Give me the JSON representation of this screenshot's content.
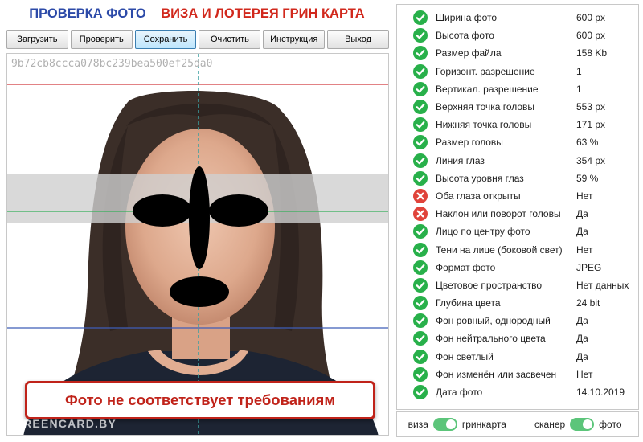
{
  "header": {
    "title_left": "ПРОВЕРКА ФОТО",
    "title_right": "ВИЗА И ЛОТЕРЕЯ ГРИН КАРТА"
  },
  "toolbar": {
    "load_label": "Загрузить",
    "check_label": "Проверить",
    "save_label": "Сохранить",
    "clear_label": "Очистить",
    "instruction_label": "Инструкция",
    "exit_label": "Выход"
  },
  "photo": {
    "hash": "9b72cb8ccca078bc239bea500ef25da0",
    "verdict": "Фото не соответствует требованиям",
    "watermark": "GREENCARD.BY"
  },
  "colors": {
    "pass": "#28b04a",
    "fail": "#e0433a",
    "title_blue": "#2c4aa8",
    "title_red": "#d1281c",
    "toggle_on": "#5cc57a"
  },
  "checks": [
    {
      "label": "Ширина фото",
      "value": "600 px",
      "status": "ok"
    },
    {
      "label": "Высота фото",
      "value": "600 px",
      "status": "ok"
    },
    {
      "label": "Размер файла",
      "value": "158 Kb",
      "status": "ok"
    },
    {
      "label": "Горизонт. разрешение",
      "value": "1",
      "status": "ok"
    },
    {
      "label": "Вертикал. разрешение",
      "value": "1",
      "status": "ok"
    },
    {
      "label": "Верхняя точка головы",
      "value": "553 px",
      "status": "ok"
    },
    {
      "label": "Нижняя точка головы",
      "value": "171 px",
      "status": "ok"
    },
    {
      "label": "Размер головы",
      "value": "63 %",
      "status": "ok"
    },
    {
      "label": "Линия глаз",
      "value": "354 px",
      "status": "ok"
    },
    {
      "label": "Высота уровня глаз",
      "value": "59 %",
      "status": "ok"
    },
    {
      "label": "Оба глаза открыты",
      "value": "Нет",
      "status": "fail"
    },
    {
      "label": "Наклон или поворот головы",
      "value": "Да",
      "status": "fail"
    },
    {
      "label": "Лицо по центру фото",
      "value": "Да",
      "status": "ok"
    },
    {
      "label": "Тени на лице (боковой свет)",
      "value": "Нет",
      "status": "ok"
    },
    {
      "label": "Формат фото",
      "value": "JPEG",
      "status": "ok"
    },
    {
      "label": "Цветовое пространство",
      "value": "Нет данных",
      "status": "ok"
    },
    {
      "label": "Глубина цвета",
      "value": "24 bit",
      "status": "ok"
    },
    {
      "label": "Фон ровный, однородный",
      "value": "Да",
      "status": "ok"
    },
    {
      "label": "Фон нейтрального цвета",
      "value": "Да",
      "status": "ok"
    },
    {
      "label": "Фон светлый",
      "value": "Да",
      "status": "ok"
    },
    {
      "label": "Фон изменён или засвечен",
      "value": "Нет",
      "status": "ok"
    },
    {
      "label": "Дата фото",
      "value": "14.10.2019",
      "status": "ok"
    }
  ],
  "toggles": {
    "left_off": "виза",
    "left_on": "гринкарта",
    "right_off": "сканер",
    "right_on": "фото"
  }
}
